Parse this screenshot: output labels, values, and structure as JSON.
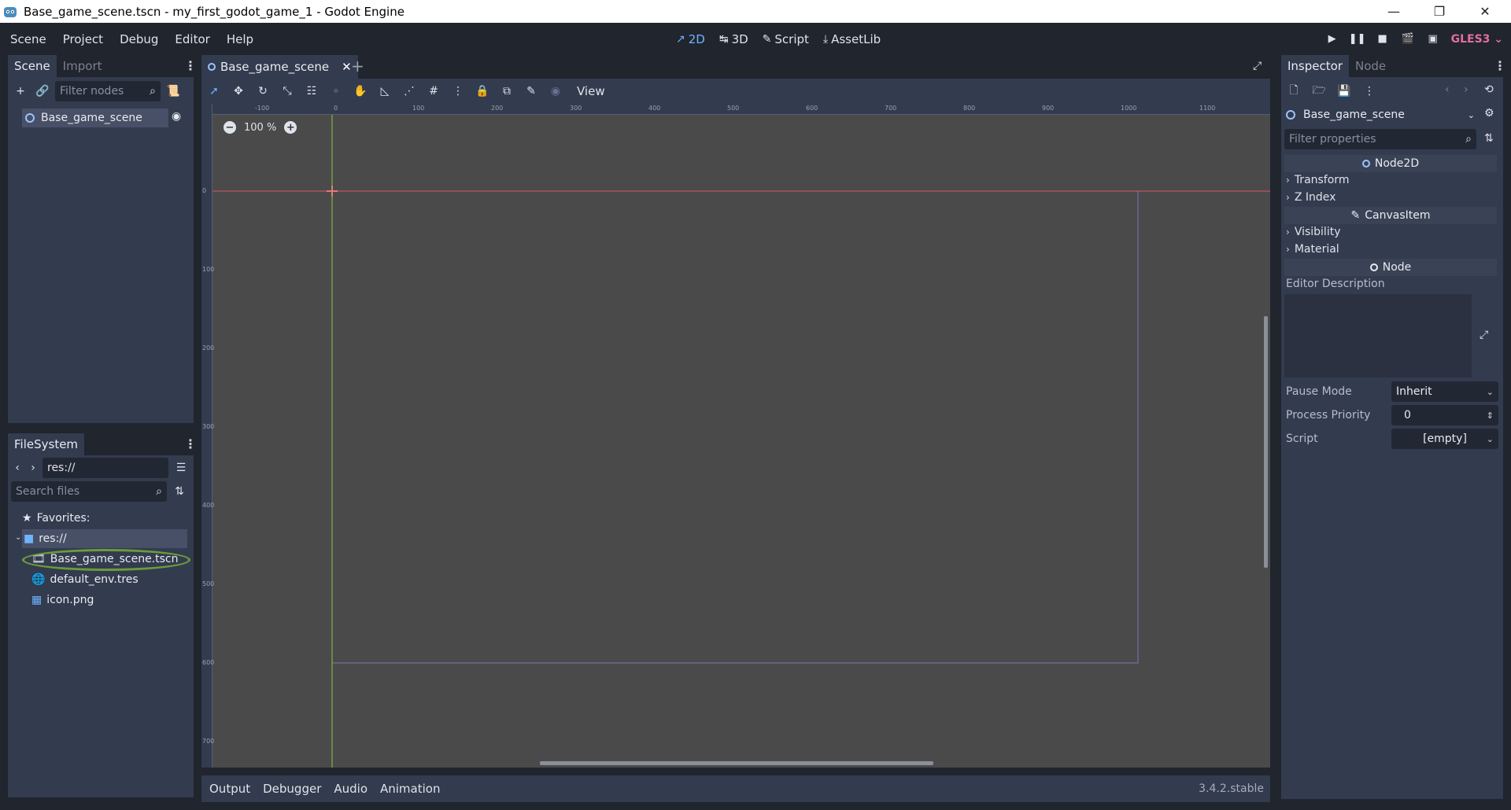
{
  "window": {
    "title": "Base_game_scene.tscn - my_first_godot_game_1 - Godot Engine",
    "minimize": "—",
    "maximize": "❐",
    "close": "✕"
  },
  "menu": [
    "Scene",
    "Project",
    "Debug",
    "Editor",
    "Help"
  ],
  "workspaces": [
    {
      "label": "2D",
      "icon": "↗",
      "active": true
    },
    {
      "label": "3D",
      "icon": "↹",
      "active": false
    },
    {
      "label": "Script",
      "icon": "✎",
      "active": false
    },
    {
      "label": "AssetLib",
      "icon": "⤓",
      "active": false
    }
  ],
  "renderer": "GLES3 ⌄",
  "scene_dock": {
    "tabs": [
      "Scene",
      "Import"
    ],
    "filter_placeholder": "Filter nodes",
    "root_node": "Base_game_scene"
  },
  "filesystem": {
    "tab": "FileSystem",
    "path": "res://",
    "search_placeholder": "Search files",
    "favorites": "Favorites:",
    "root": "res://",
    "files": [
      "Base_game_scene.tscn",
      "default_env.tres",
      "icon.png"
    ]
  },
  "editor": {
    "scene_tab": "Base_game_scene",
    "add_tab": "+",
    "view_menu": "View",
    "zoom": "100 %",
    "ruler_x": [
      "-100",
      "0",
      "100",
      "200",
      "300",
      "400",
      "500",
      "600",
      "700",
      "800",
      "900",
      "1000",
      "1100"
    ],
    "ruler_y": [
      "0",
      "100",
      "200",
      "300",
      "400",
      "500",
      "600",
      "700"
    ]
  },
  "bottom": {
    "tabs": [
      "Output",
      "Debugger",
      "Audio",
      "Animation"
    ],
    "version": "3.4.2.stable"
  },
  "inspector": {
    "tabs": [
      "Inspector",
      "Node"
    ],
    "object": "Base_game_scene",
    "filter_placeholder": "Filter properties",
    "sections": {
      "node2d": "Node2D",
      "transform": "Transform",
      "z_index": "Z Index",
      "canvasitem": "CanvasItem",
      "visibility": "Visibility",
      "material": "Material",
      "node": "Node"
    },
    "editor_description": "Editor Description",
    "pause_mode_label": "Pause Mode",
    "pause_mode_value": "Inherit",
    "process_priority_label": "Process Priority",
    "process_priority_value": "0",
    "script_label": "Script",
    "script_value": "[empty]"
  },
  "colors": {
    "accent": "#6fb3ff",
    "renderer": "#e26f9f",
    "highlight_ellipse": "#6a9c3a",
    "x_axis": "#d9566b",
    "y_axis": "#8ec63f"
  }
}
